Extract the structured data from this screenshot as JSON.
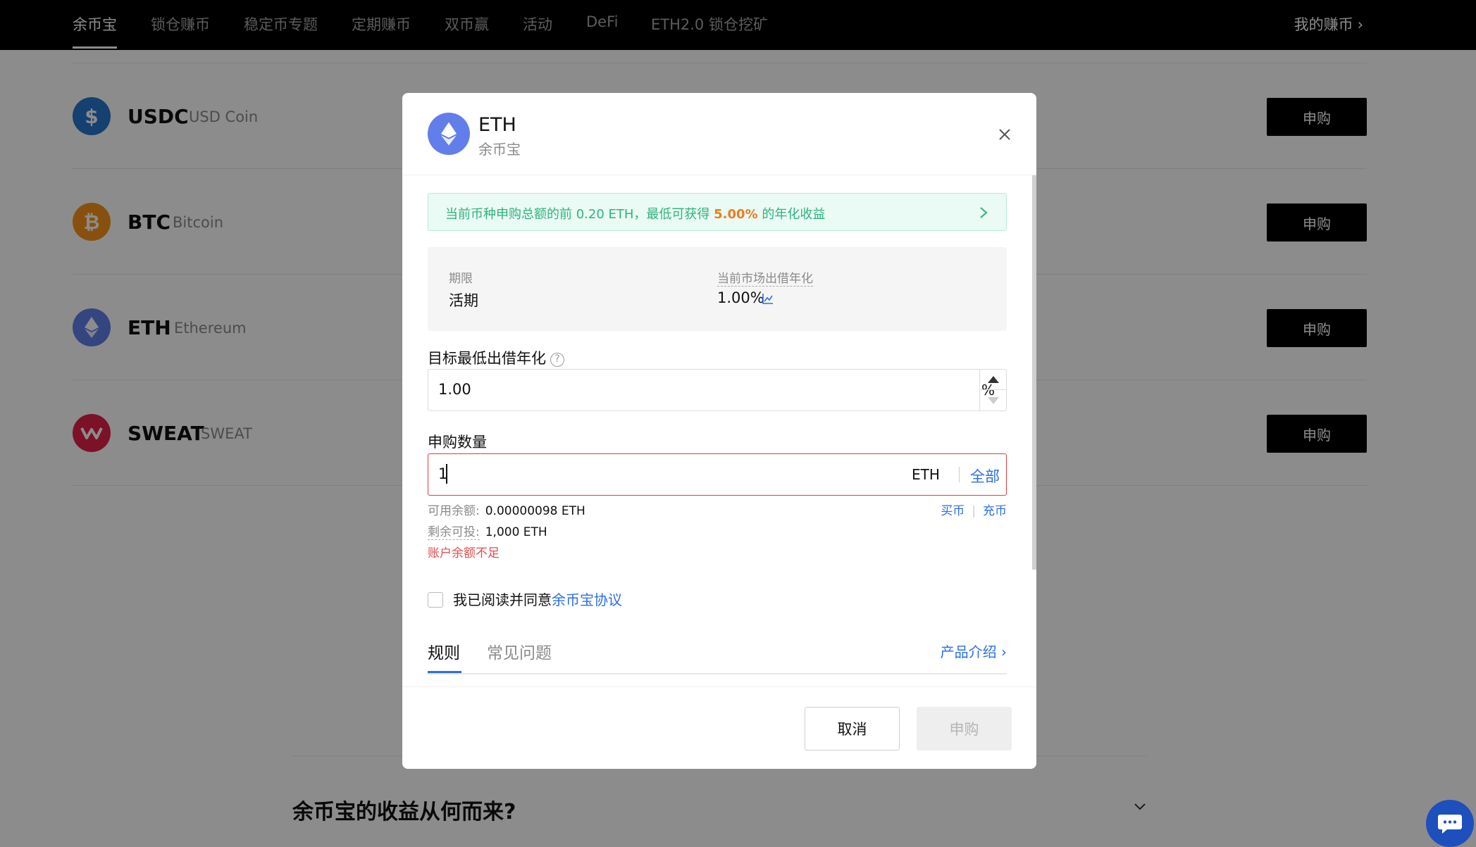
{
  "nav": {
    "items": [
      "余币宝",
      "锁仓赚币",
      "稳定币专题",
      "定期赚币",
      "双币赢",
      "活动",
      "DeFi",
      "ETH2.0 锁仓挖矿"
    ],
    "right": "我的赚币"
  },
  "coins": [
    {
      "symbol": "USDC",
      "name": "USD Coin",
      "color": "#2775ca",
      "icon": "usdc-icon",
      "button": "申购"
    },
    {
      "symbol": "BTC",
      "name": "Bitcoin",
      "color": "#f7931a",
      "icon": "btc-icon",
      "button": "申购"
    },
    {
      "symbol": "ETH",
      "name": "Ethereum",
      "color": "#627eea",
      "icon": "eth-icon",
      "button": "申购"
    },
    {
      "symbol": "SWEAT",
      "name": "SWEAT",
      "color": "#e0224a",
      "icon": "sweat-icon",
      "button": "申购"
    }
  ],
  "faq": {
    "title": "余币宝的收益从何而来?"
  },
  "modal": {
    "title": "ETH",
    "subtitle": "余币宝",
    "banner": {
      "prefix": "当前币种申购总额的前 0.20 ETH，最低可获得 ",
      "highlight": "5.00%",
      "suffix": " 的年化收益"
    },
    "term_label": "期限",
    "term_value": "活期",
    "market_label": "当前市场出借年化",
    "market_value": "1.00%",
    "target_label": "目标最低出借年化",
    "target_value": "1.00",
    "target_unit": "%",
    "amount_label": "申购数量",
    "amount_value": "1",
    "amount_unit": "ETH",
    "amount_all": "全部",
    "available_label": "可用余额:",
    "available_value": "0.00000098 ETH",
    "remaining_label": "剩余可投:",
    "remaining_value": "1,000 ETH",
    "error": "账户余额不足",
    "buy_link": "买币",
    "deposit_link": "充币",
    "agree_text": "我已阅读并同意",
    "agree_link": "余币宝协议",
    "tab_rules": "规则",
    "tab_faq": "常见问题",
    "product_intro": "产品介绍",
    "cancel": "取消",
    "submit": "申购"
  },
  "colors": {
    "accent": "#2b6ee8",
    "success": "#2fb37d",
    "error": "#e54d4d",
    "highlight": "#ee7d1e"
  }
}
